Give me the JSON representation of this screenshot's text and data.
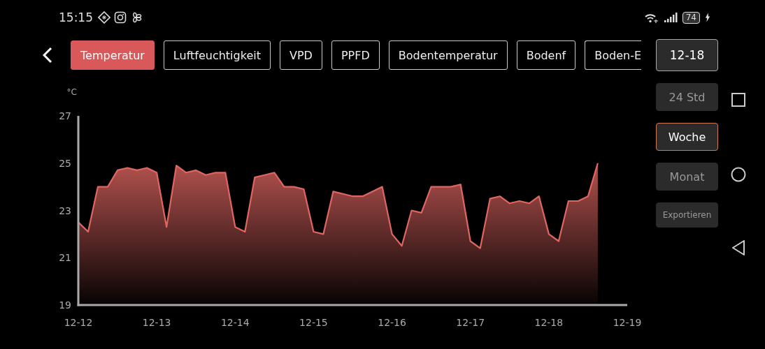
{
  "status_bar": {
    "time": "15:15",
    "battery": "74"
  },
  "tabs": [
    {
      "label": "Temperatur",
      "selected": true
    },
    {
      "label": "Luftfeuchtigkeit",
      "selected": false
    },
    {
      "label": "VPD",
      "selected": false
    },
    {
      "label": "PPFD",
      "selected": false
    },
    {
      "label": "Bodentemperatur",
      "selected": false
    },
    {
      "label": "Bodenf",
      "selected": false
    },
    {
      "label": "Boden-E",
      "selected": false
    }
  ],
  "date_button": "12-18",
  "ranges": [
    {
      "label": "24 Std",
      "selected": false
    },
    {
      "label": "Woche",
      "selected": true
    },
    {
      "label": "Monat",
      "selected": false
    }
  ],
  "export_button": "Exportieren",
  "chart": {
    "chart_data": {
      "type": "area",
      "ylabel": "°C",
      "ylim": [
        19,
        27
      ],
      "yticks": [
        19,
        21,
        23,
        25,
        27
      ],
      "categories": [
        "12-12",
        null,
        null,
        null,
        null,
        null,
        null,
        null,
        "12-13",
        null,
        null,
        null,
        null,
        null,
        null,
        null,
        "12-14",
        null,
        null,
        null,
        null,
        null,
        null,
        null,
        "12-15",
        null,
        null,
        null,
        null,
        null,
        null,
        null,
        "12-16",
        null,
        null,
        null,
        null,
        null,
        null,
        null,
        "12-17",
        null,
        null,
        null,
        null,
        null,
        null,
        null,
        "12-18",
        null,
        null,
        null,
        null,
        null,
        null,
        null,
        "12-19"
      ],
      "series": [
        {
          "color": "#e06662",
          "values": [
            22.5,
            22.1,
            24.0,
            24.0,
            24.7,
            24.8,
            24.7,
            24.8,
            24.6,
            22.3,
            24.9,
            24.6,
            24.7,
            24.5,
            24.6,
            24.6,
            22.3,
            22.1,
            24.4,
            24.5,
            24.6,
            24.0,
            24.0,
            23.9,
            22.1,
            22.0,
            23.8,
            23.7,
            23.6,
            23.6,
            23.8,
            24.0,
            22.0,
            21.5,
            23.0,
            22.9,
            24.0,
            24.0,
            24.0,
            24.1,
            21.7,
            21.4,
            23.5,
            23.6,
            23.3,
            23.4,
            23.3,
            23.6,
            22.0,
            21.7,
            23.4,
            23.4,
            23.6,
            25.0,
            null,
            null,
            null
          ]
        }
      ]
    }
  }
}
